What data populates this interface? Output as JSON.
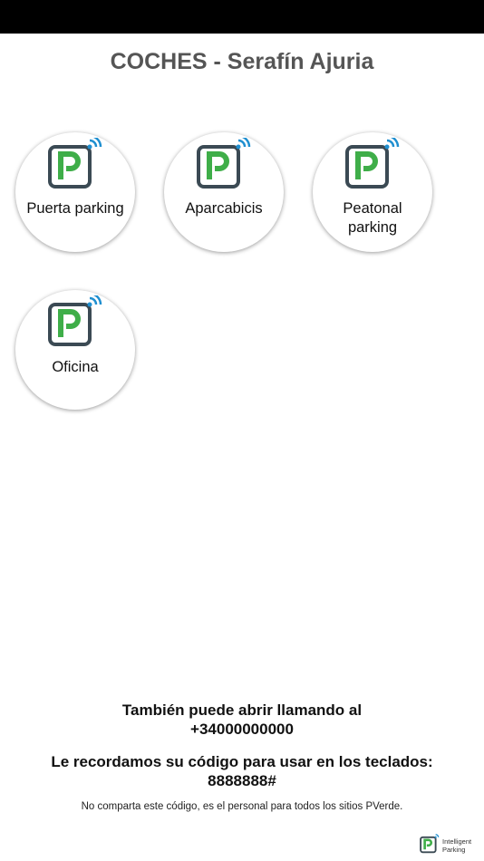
{
  "header": {
    "title": "COCHES - Serafín Ajuria"
  },
  "tiles": [
    {
      "label": "Puerta parking",
      "icon": "parking-wifi-icon"
    },
    {
      "label": "Aparcabicis",
      "icon": "parking-wifi-icon"
    },
    {
      "label": "Peatonal parking",
      "icon": "parking-wifi-icon"
    },
    {
      "label": "Oficina",
      "icon": "parking-wifi-icon"
    }
  ],
  "info": {
    "call_text": "También puede abrir llamando al",
    "phone": "+34000000000",
    "code_text": "Le recordamos su código para usar en los teclados:",
    "code": "8888888#",
    "note": "No comparta este código, es el personal para todos los sitios PVerde."
  },
  "footer": {
    "brand_line1": "Intelligent",
    "brand_line2": "Parking"
  },
  "colors": {
    "accent_green": "#3fae49",
    "wifi_blue": "#1f8fd0",
    "frame_dark": "#3b4a54"
  }
}
